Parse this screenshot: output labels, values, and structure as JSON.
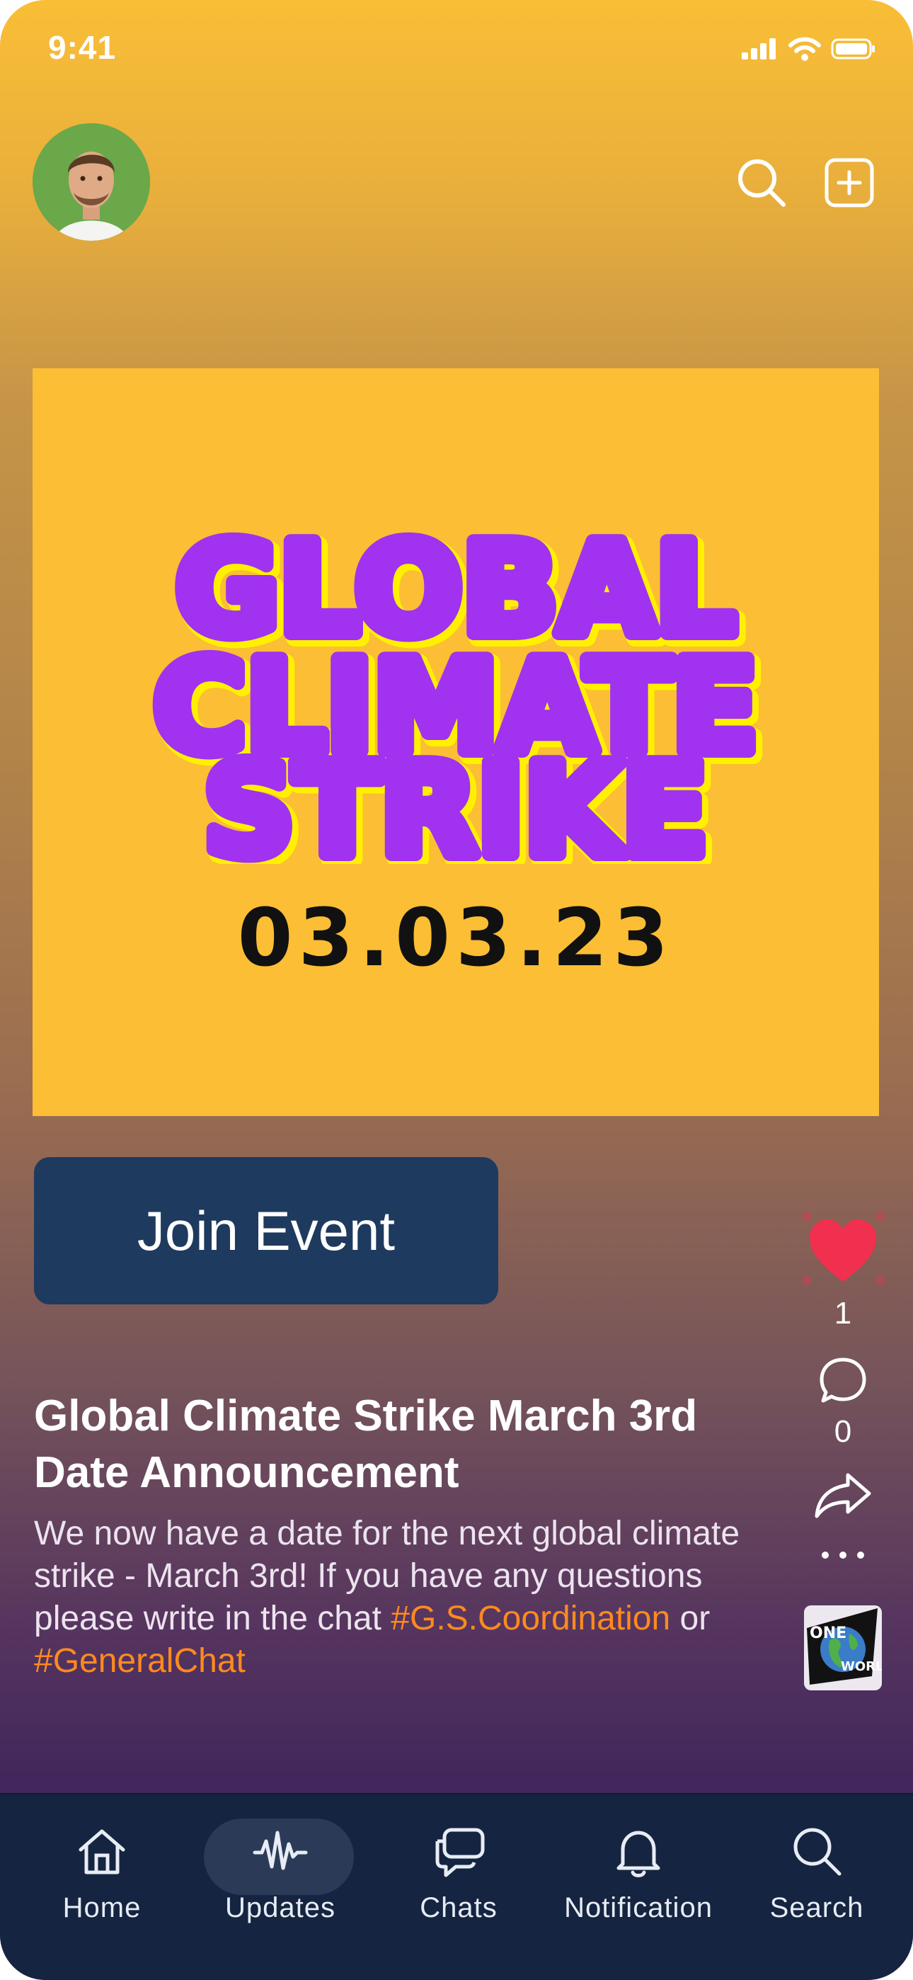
{
  "status": {
    "time": "9:41"
  },
  "header": {
    "avatar_alt": "profile photo",
    "search_icon": "search-icon",
    "add_icon": "plus-square-icon"
  },
  "poster": {
    "line1": "GLOBAL",
    "line2": "CLIMATE",
    "line3": "STRIKE",
    "date": "03.03.23",
    "background": "#FBBE34",
    "title_color": "#A032F0",
    "shadow_color": "#FFF000"
  },
  "post": {
    "join_label": "Join Event",
    "title": "Global Climate Strike March 3rd Date Announcement",
    "body_text": "We now have a date for the next global climate strike - March 3rd! If you have any questions please write in the chat",
    "tag1": "#G.S.Coordination",
    "connector": "or",
    "tag2": "#GeneralChat",
    "tag_color": "#FF8A1F"
  },
  "side": {
    "likes": "1",
    "comments": "0",
    "channel_badge_line1": "ONE",
    "channel_badge_line2": "WORLD"
  },
  "nav": {
    "items": [
      {
        "label": "Home",
        "icon": "home-icon"
      },
      {
        "label": "Updates",
        "icon": "waveform-icon",
        "active": true
      },
      {
        "label": "Chats",
        "icon": "chat-bubbles-icon"
      },
      {
        "label": "Notification",
        "icon": "bell-icon"
      },
      {
        "label": "Search",
        "icon": "search-icon"
      }
    ]
  },
  "colors": {
    "accent_like": "#F0304E",
    "join_button": "#1F3A5F",
    "nav_bg": "#152440"
  }
}
